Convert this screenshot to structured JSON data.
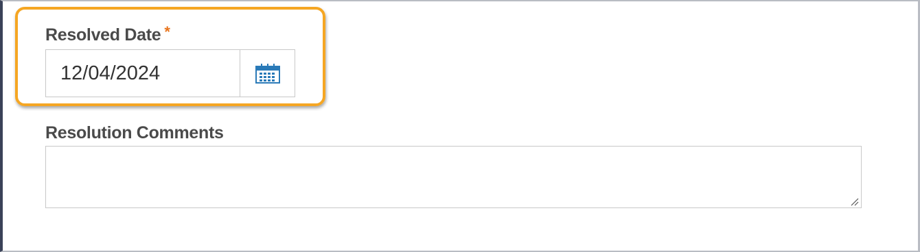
{
  "resolved_date": {
    "label": "Resolved Date",
    "required_marker": "*",
    "value": "12/04/2024",
    "calendar_icon": "calendar-icon"
  },
  "resolution_comments": {
    "label": "Resolution Comments",
    "value": ""
  },
  "colors": {
    "highlight": "#f5a623",
    "required": "#e8741c",
    "icon": "#2a7ab8"
  }
}
